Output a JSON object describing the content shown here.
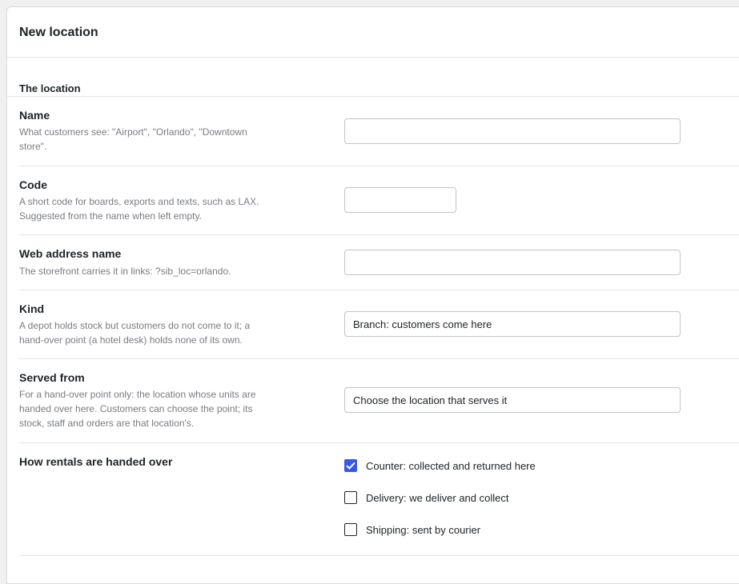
{
  "header": {
    "title": "New location"
  },
  "section": {
    "title": "The location"
  },
  "fields": {
    "name": {
      "label": "Name",
      "help": "What customers see: \"Airport\", \"Orlando\", \"Downtown store\".",
      "value": ""
    },
    "code": {
      "label": "Code",
      "help": "A short code for boards, exports and texts, such as LAX. Suggested from the name when left empty.",
      "value": ""
    },
    "web": {
      "label": "Web address name",
      "help": "The storefront carries it in links: ?sib_loc=orlando.",
      "value": ""
    },
    "kind": {
      "label": "Kind",
      "help": "A depot holds stock but customers do not come to it; a hand-over point (a hotel desk) holds none of its own.",
      "value": "Branch: customers come here"
    },
    "served": {
      "label": "Served from",
      "help": "For a hand-over point only: the location whose units are handed over here. Customers can choose the point; its stock, staff and orders are that location's.",
      "value": "Choose the location that serves it"
    }
  },
  "handover": {
    "label": "How rentals are handed over",
    "options": [
      {
        "label": "Counter: collected and returned here",
        "checked": true
      },
      {
        "label": "Delivery: we deliver and collect",
        "checked": false
      },
      {
        "label": "Shipping: sent by courier",
        "checked": false
      }
    ]
  },
  "colors": {
    "accent": "#3858e9",
    "help_text": "#787c82",
    "border": "#c3c4c7"
  }
}
